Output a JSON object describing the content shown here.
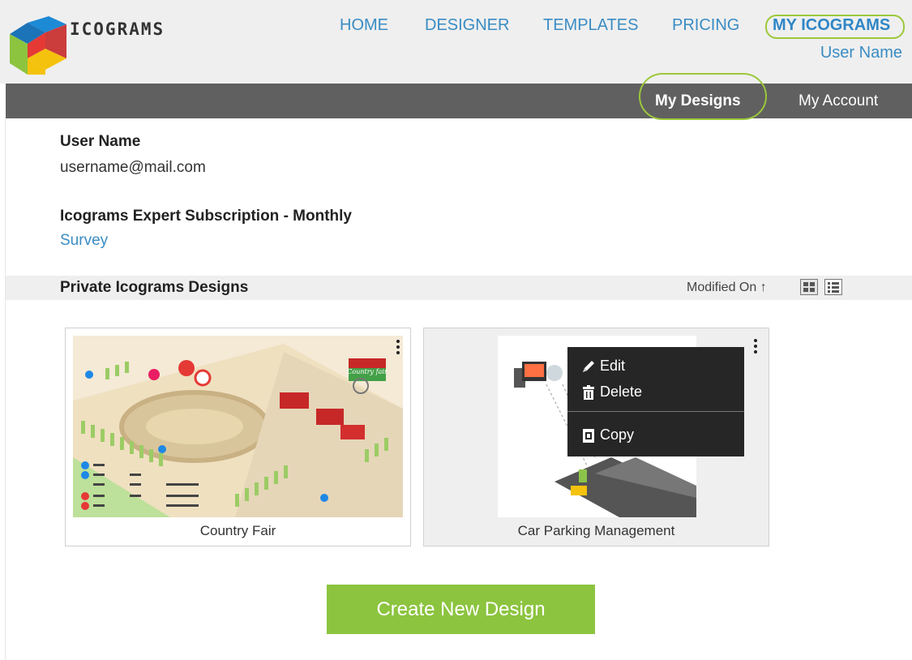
{
  "brand": {
    "name": "ICOGRAMS"
  },
  "nav": {
    "items": [
      "HOME",
      "DESIGNER",
      "TEMPLATES",
      "PRICING",
      "MY ICOGRAMS"
    ],
    "user": "User Name"
  },
  "subnav": {
    "items": [
      "My Designs",
      "My Account"
    ]
  },
  "account": {
    "name": "User Name",
    "email": "username@mail.com",
    "subscription": "Icograms Expert Subscription - Monthly",
    "survey_link": "Survey"
  },
  "designs": {
    "section_title": "Private Icograms Designs",
    "sort_label": "Modified On ↑",
    "cards": [
      {
        "title": "Country Fair",
        "badge": "Country fair"
      },
      {
        "title": "Car Parking Management"
      }
    ],
    "context_menu": [
      "Edit",
      "Delete",
      "Copy"
    ]
  },
  "create_button": "Create New Design",
  "colors": {
    "accent_blue": "#3a8cc4",
    "subnav_bg": "#606060",
    "create_green": "#8cc43f",
    "highlight_circle": "#9cc83b",
    "menu_bg": "#262626"
  }
}
